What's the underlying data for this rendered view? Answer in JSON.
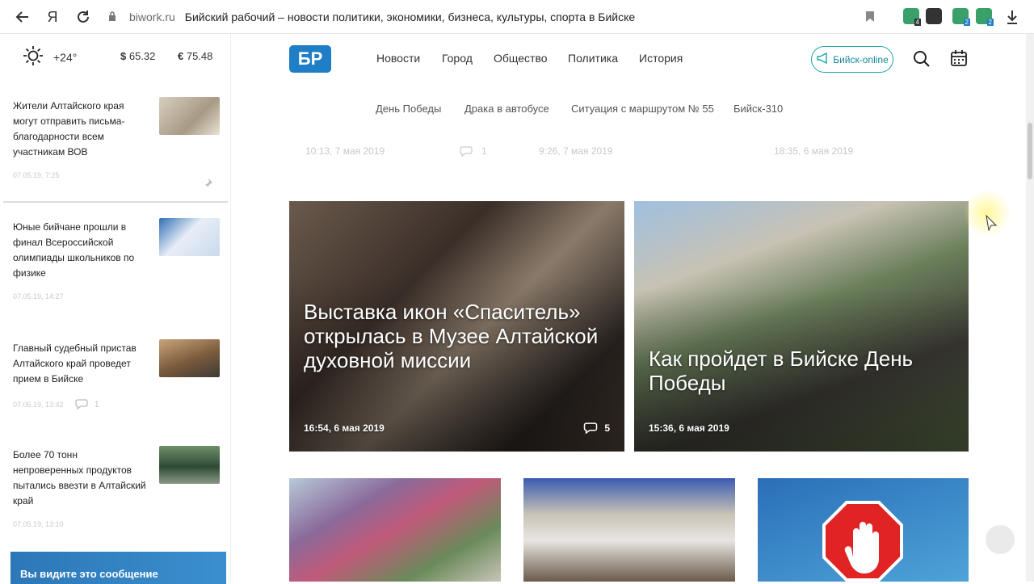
{
  "browser": {
    "logo_letter": "Я",
    "domain": "biwork.ru",
    "title": "Бийский рабочий – новости политики, экономики, бизнеса, культуры, спорта в Бийске",
    "ext_badges": [
      "4",
      "2",
      "2"
    ]
  },
  "weather": {
    "temperature": "+24°"
  },
  "currency": {
    "usd_symbol": "$",
    "usd": "65.32",
    "eur_symbol": "€",
    "eur": "75.48"
  },
  "logo": {
    "text": "БР"
  },
  "menu": {
    "items": [
      "Новости",
      "Город",
      "Общество",
      "Политика",
      "История"
    ]
  },
  "online_button": {
    "label": "Бийск-online"
  },
  "tags": [
    "День Победы",
    "Драка в автобусе",
    "Ситуация с маршрутом № 55",
    "Бийск-310"
  ],
  "ghost_meta": {
    "date1": "10:13, 7 мая 2019",
    "comments1": "1",
    "date2": "9:26, 7 мая 2019",
    "date3": "18:35, 6 мая 2019"
  },
  "sidebar_news": [
    {
      "title": "Жители Алтайского края могут отправить письма-благодарности всем участникам ВОВ",
      "date": "07.05.19, 7:25",
      "comments": ""
    },
    {
      "title": "Юные бийчане прошли в финал Всероссийской олимпиады школьников по физике",
      "date": "07.05.19, 14:27",
      "comments": ""
    },
    {
      "title": "Главный судебный пристав Алтайского край проведет прием в Бийске",
      "date": "07.05.19, 13:42",
      "comments": "1"
    },
    {
      "title": "Более 70 тонн непроверенных продуктов пытались ввезти в Алтайский край",
      "date": "07.05.19, 13:10",
      "comments": ""
    }
  ],
  "sidebar_banner": {
    "text": "Вы видите это сообщение"
  },
  "featured": [
    {
      "title": "Выставка икон «Спаситель» открылась в Музее Алтайской духовной миссии",
      "date": "16:54, 6 мая 2019",
      "comments": "5"
    },
    {
      "title": "Как пройдет в Бийске День Победы",
      "date": "15:36, 6 мая 2019",
      "comments": ""
    }
  ],
  "colors": {
    "brand": "#1f7fc6",
    "accent_online": "#17a6a6"
  }
}
